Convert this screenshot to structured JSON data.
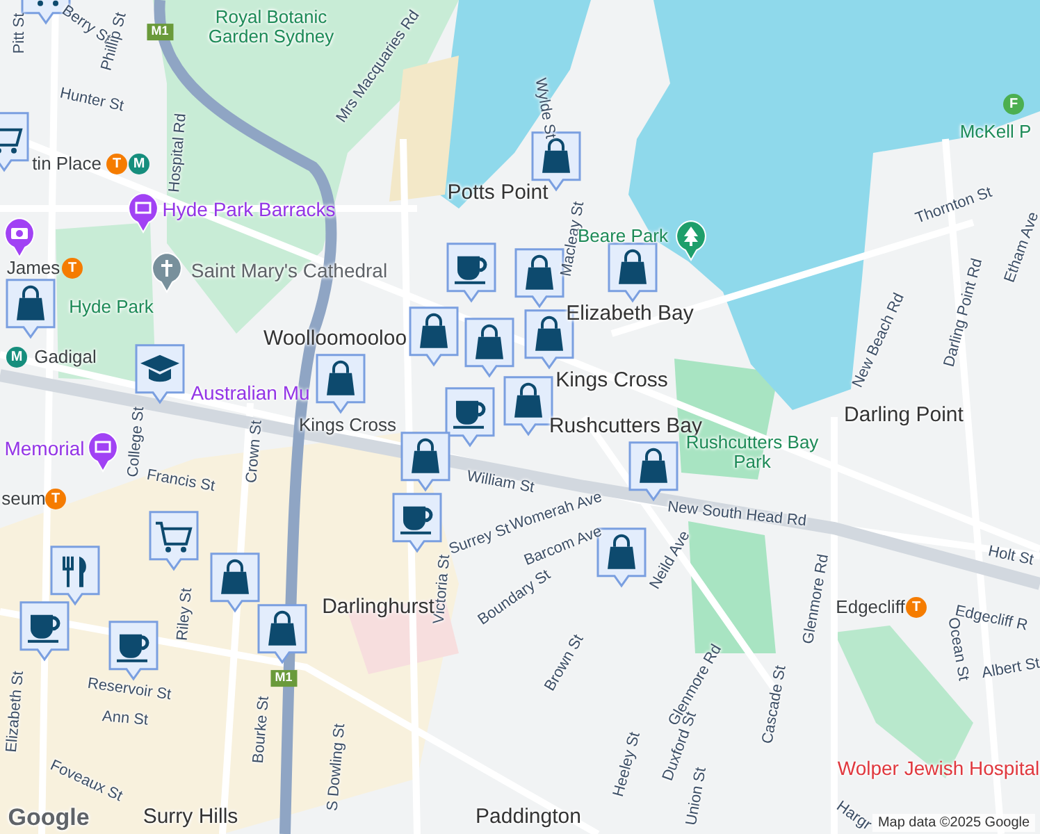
{
  "map": {
    "labels": [
      {
        "text": "Pitt St",
        "kind": "street"
      },
      {
        "text": "Berry St",
        "kind": "street"
      },
      {
        "text": "Phillip St",
        "kind": "street"
      },
      {
        "text": "M1",
        "kind": "shield"
      },
      {
        "text": "Royal Botanic Garden Sydney",
        "kind": "park"
      },
      {
        "text": "Hunter St",
        "kind": "street"
      },
      {
        "text": "Hospital Rd",
        "kind": "street"
      },
      {
        "text": "Mrs Macquaries Rd",
        "kind": "street"
      },
      {
        "text": "Wylde St",
        "kind": "street"
      },
      {
        "text": "tin Place",
        "kind": "station"
      },
      {
        "text": "T",
        "kind": "train"
      },
      {
        "text": "M",
        "kind": "metro"
      },
      {
        "text": "Potts Point",
        "kind": "suburb"
      },
      {
        "text": "Hyde Park Barracks",
        "kind": "poi"
      },
      {
        "text": "McKell P",
        "kind": "park"
      },
      {
        "text": "F",
        "kind": "ferry"
      },
      {
        "text": "Thornton St",
        "kind": "street"
      },
      {
        "text": "Macleay St",
        "kind": "street"
      },
      {
        "text": "Beare Park",
        "kind": "park"
      },
      {
        "text": "James",
        "kind": "station"
      },
      {
        "text": "T",
        "kind": "train"
      },
      {
        "text": "Saint Mary's Cathedral",
        "kind": "church"
      },
      {
        "text": "Etham Ave",
        "kind": "street"
      },
      {
        "text": "Hyde Park",
        "kind": "park"
      },
      {
        "text": "Elizabeth Bay",
        "kind": "suburb"
      },
      {
        "text": "Darling Point Rd",
        "kind": "street"
      },
      {
        "text": "New Beach Rd",
        "kind": "street"
      },
      {
        "text": "Woolloomooloo",
        "kind": "suburb"
      },
      {
        "text": "M",
        "kind": "metro"
      },
      {
        "text": "Gadigal",
        "kind": "station"
      },
      {
        "text": "Kings Cross",
        "kind": "suburb"
      },
      {
        "text": "Australian Mu",
        "kind": "poi"
      },
      {
        "text": "Darling Point",
        "kind": "suburb"
      },
      {
        "text": "Kings Cross",
        "kind": "station"
      },
      {
        "text": "Rushcutters Bay",
        "kind": "suburb"
      },
      {
        "text": "Memorial",
        "kind": "poi"
      },
      {
        "text": "Rushcutters Bay Park",
        "kind": "park"
      },
      {
        "text": "College St",
        "kind": "street"
      },
      {
        "text": "Francis St",
        "kind": "street"
      },
      {
        "text": "Crown St",
        "kind": "street"
      },
      {
        "text": "William St",
        "kind": "street"
      },
      {
        "text": "seum",
        "kind": "station"
      },
      {
        "text": "T",
        "kind": "train"
      },
      {
        "text": "New South Head Rd",
        "kind": "street"
      },
      {
        "text": "Surrey St",
        "kind": "street"
      },
      {
        "text": "Womerah Ave",
        "kind": "street"
      },
      {
        "text": "Barcom Ave",
        "kind": "street"
      },
      {
        "text": "Victoria St",
        "kind": "street"
      },
      {
        "text": "Holt St",
        "kind": "street"
      },
      {
        "text": "Neild Ave",
        "kind": "street"
      },
      {
        "text": "Riley St",
        "kind": "street"
      },
      {
        "text": "Boundary St",
        "kind": "street"
      },
      {
        "text": "Glenmore Rd",
        "kind": "street"
      },
      {
        "text": "Darlinghurst",
        "kind": "suburb"
      },
      {
        "text": "Edgecliff",
        "kind": "station"
      },
      {
        "text": "T",
        "kind": "train"
      },
      {
        "text": "Edgecliff R",
        "kind": "street"
      },
      {
        "text": "Ocean St",
        "kind": "street"
      },
      {
        "text": "Brown St",
        "kind": "street"
      },
      {
        "text": "Albert St",
        "kind": "street"
      },
      {
        "text": "M1",
        "kind": "shield"
      },
      {
        "text": "Glenmore Rd",
        "kind": "street"
      },
      {
        "text": "Reservoir St",
        "kind": "street"
      },
      {
        "text": "Cascade St",
        "kind": "street"
      },
      {
        "text": "Elizabeth St",
        "kind": "street"
      },
      {
        "text": "Ann St",
        "kind": "street"
      },
      {
        "text": "Bourke St",
        "kind": "street"
      },
      {
        "text": "Duxford St",
        "kind": "street"
      },
      {
        "text": "Heeley St",
        "kind": "street"
      },
      {
        "text": "S Dowling St",
        "kind": "street"
      },
      {
        "text": "Wolper Jewish Hospital",
        "kind": "hospital"
      },
      {
        "text": "Foveaux St",
        "kind": "street"
      },
      {
        "text": "Union St",
        "kind": "street"
      },
      {
        "text": "Google",
        "kind": "logo"
      },
      {
        "text": "Surry Hills",
        "kind": "suburb"
      },
      {
        "text": "Paddington",
        "kind": "suburb"
      },
      {
        "text": "Hargr",
        "kind": "street"
      },
      {
        "text": "Map data ©2025 Google",
        "kind": "credit"
      }
    ],
    "markers": [
      {
        "kind": "grocery"
      },
      {
        "kind": "grocery"
      },
      {
        "kind": "shopping"
      },
      {
        "kind": "museum"
      },
      {
        "kind": "camera"
      },
      {
        "kind": "cafe"
      },
      {
        "kind": "church"
      },
      {
        "kind": "park"
      },
      {
        "kind": "shopping"
      },
      {
        "kind": "shopping"
      },
      {
        "kind": "shopping"
      },
      {
        "kind": "shopping"
      },
      {
        "kind": "shopping"
      },
      {
        "kind": "shopping"
      },
      {
        "kind": "school"
      },
      {
        "kind": "shopping"
      },
      {
        "kind": "shopping"
      },
      {
        "kind": "cafe"
      },
      {
        "kind": "shopping"
      },
      {
        "kind": "shopping"
      },
      {
        "kind": "museum"
      },
      {
        "kind": "cafe"
      },
      {
        "kind": "grocery"
      },
      {
        "kind": "restaurant"
      },
      {
        "kind": "shopping"
      },
      {
        "kind": "shopping"
      },
      {
        "kind": "cafe"
      },
      {
        "kind": "cafe"
      },
      {
        "kind": "shopping"
      }
    ]
  }
}
